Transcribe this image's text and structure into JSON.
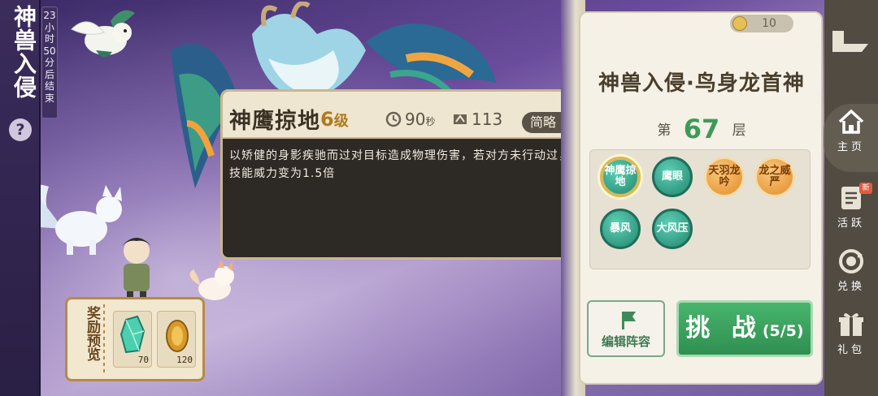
{
  "event": {
    "title": "神兽入侵",
    "help_label": "?",
    "timer": "23小时50分后结束"
  },
  "reward": {
    "label": "奖励预览",
    "items": [
      {
        "icon": "crystal-icon",
        "qty": "70"
      },
      {
        "icon": "coin-icon",
        "qty": "120"
      }
    ]
  },
  "popup": {
    "skill_name": "神鹰掠地",
    "level": "6",
    "level_unit": "级",
    "cooldown": "90",
    "cooldown_unit": "秒",
    "energy": "113",
    "brief_label": "简略",
    "description": "以矫健的身影疾驰而过对目标造成物理伤害，若对方未行动过，则技能威力变为1.5倍"
  },
  "panel": {
    "currency": "10",
    "boss_title": "神兽入侵·鸟身龙首神",
    "floor_prefix": "第",
    "floor": "67",
    "floor_suffix": "层",
    "skills": [
      {
        "label": "神鹰掠地",
        "style": "green",
        "selected": true
      },
      {
        "label": "鹰眼",
        "style": "green",
        "selected": false
      },
      {
        "label": "天羽龙吟",
        "style": "orange",
        "selected": false
      },
      {
        "label": "龙之威严",
        "style": "orange",
        "selected": false
      },
      {
        "label": "暴风",
        "style": "green",
        "selected": false
      },
      {
        "label": "大风压",
        "style": "green",
        "selected": false
      }
    ],
    "edit_label": "编辑阵容",
    "challenge_label": "挑 战",
    "challenge_count": "(5/5)"
  },
  "nav": {
    "home": "主页",
    "activity": "活跃",
    "exchange": "兑换",
    "gift": "礼包",
    "badge": "新"
  },
  "colors": {
    "accent_green": "#3f9a5a",
    "popup_bg": "#2d2925",
    "level_gold": "#b07a1e",
    "nav_bg": "#514b42"
  }
}
